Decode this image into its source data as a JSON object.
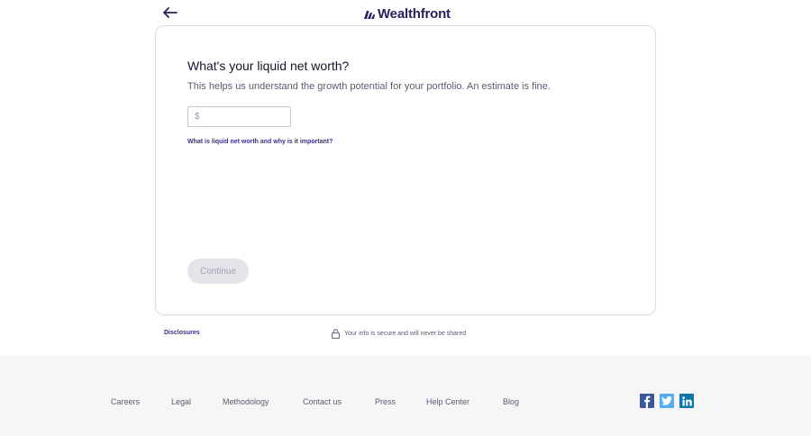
{
  "header": {
    "back_icon": "arrow-left-icon",
    "logo_text": "Wealthfront",
    "logo_icon": "wealthfront-mark-icon"
  },
  "form": {
    "title": "What's your liquid net worth?",
    "subtitle": "This helps us understand the growth potential for your portfolio. An estimate is fine.",
    "currency_symbol": "$",
    "amount_value": "",
    "help_link": "What is liquid net worth and why is it important?",
    "continue_label": "Continue"
  },
  "below_card": {
    "disclosures": "Disclosures",
    "secure_icon": "lock-icon",
    "secure_text": "Your info is secure and will never be shared"
  },
  "footer": {
    "links": [
      {
        "label": "Careers"
      },
      {
        "label": "Legal"
      },
      {
        "label": "Methodology"
      },
      {
        "label": "Contact us"
      },
      {
        "label": "Press"
      },
      {
        "label": "Help Center"
      },
      {
        "label": "Blog"
      }
    ],
    "social": [
      {
        "icon": "facebook-icon",
        "color": "#3b5998"
      },
      {
        "icon": "twitter-icon",
        "color": "#55acee"
      },
      {
        "icon": "linkedin-icon",
        "color": "#0e76a8"
      }
    ]
  },
  "colors": {
    "brand": "#2b1e5c",
    "link": "#3a2f8a",
    "footer_bg": "#f6f6f7"
  }
}
